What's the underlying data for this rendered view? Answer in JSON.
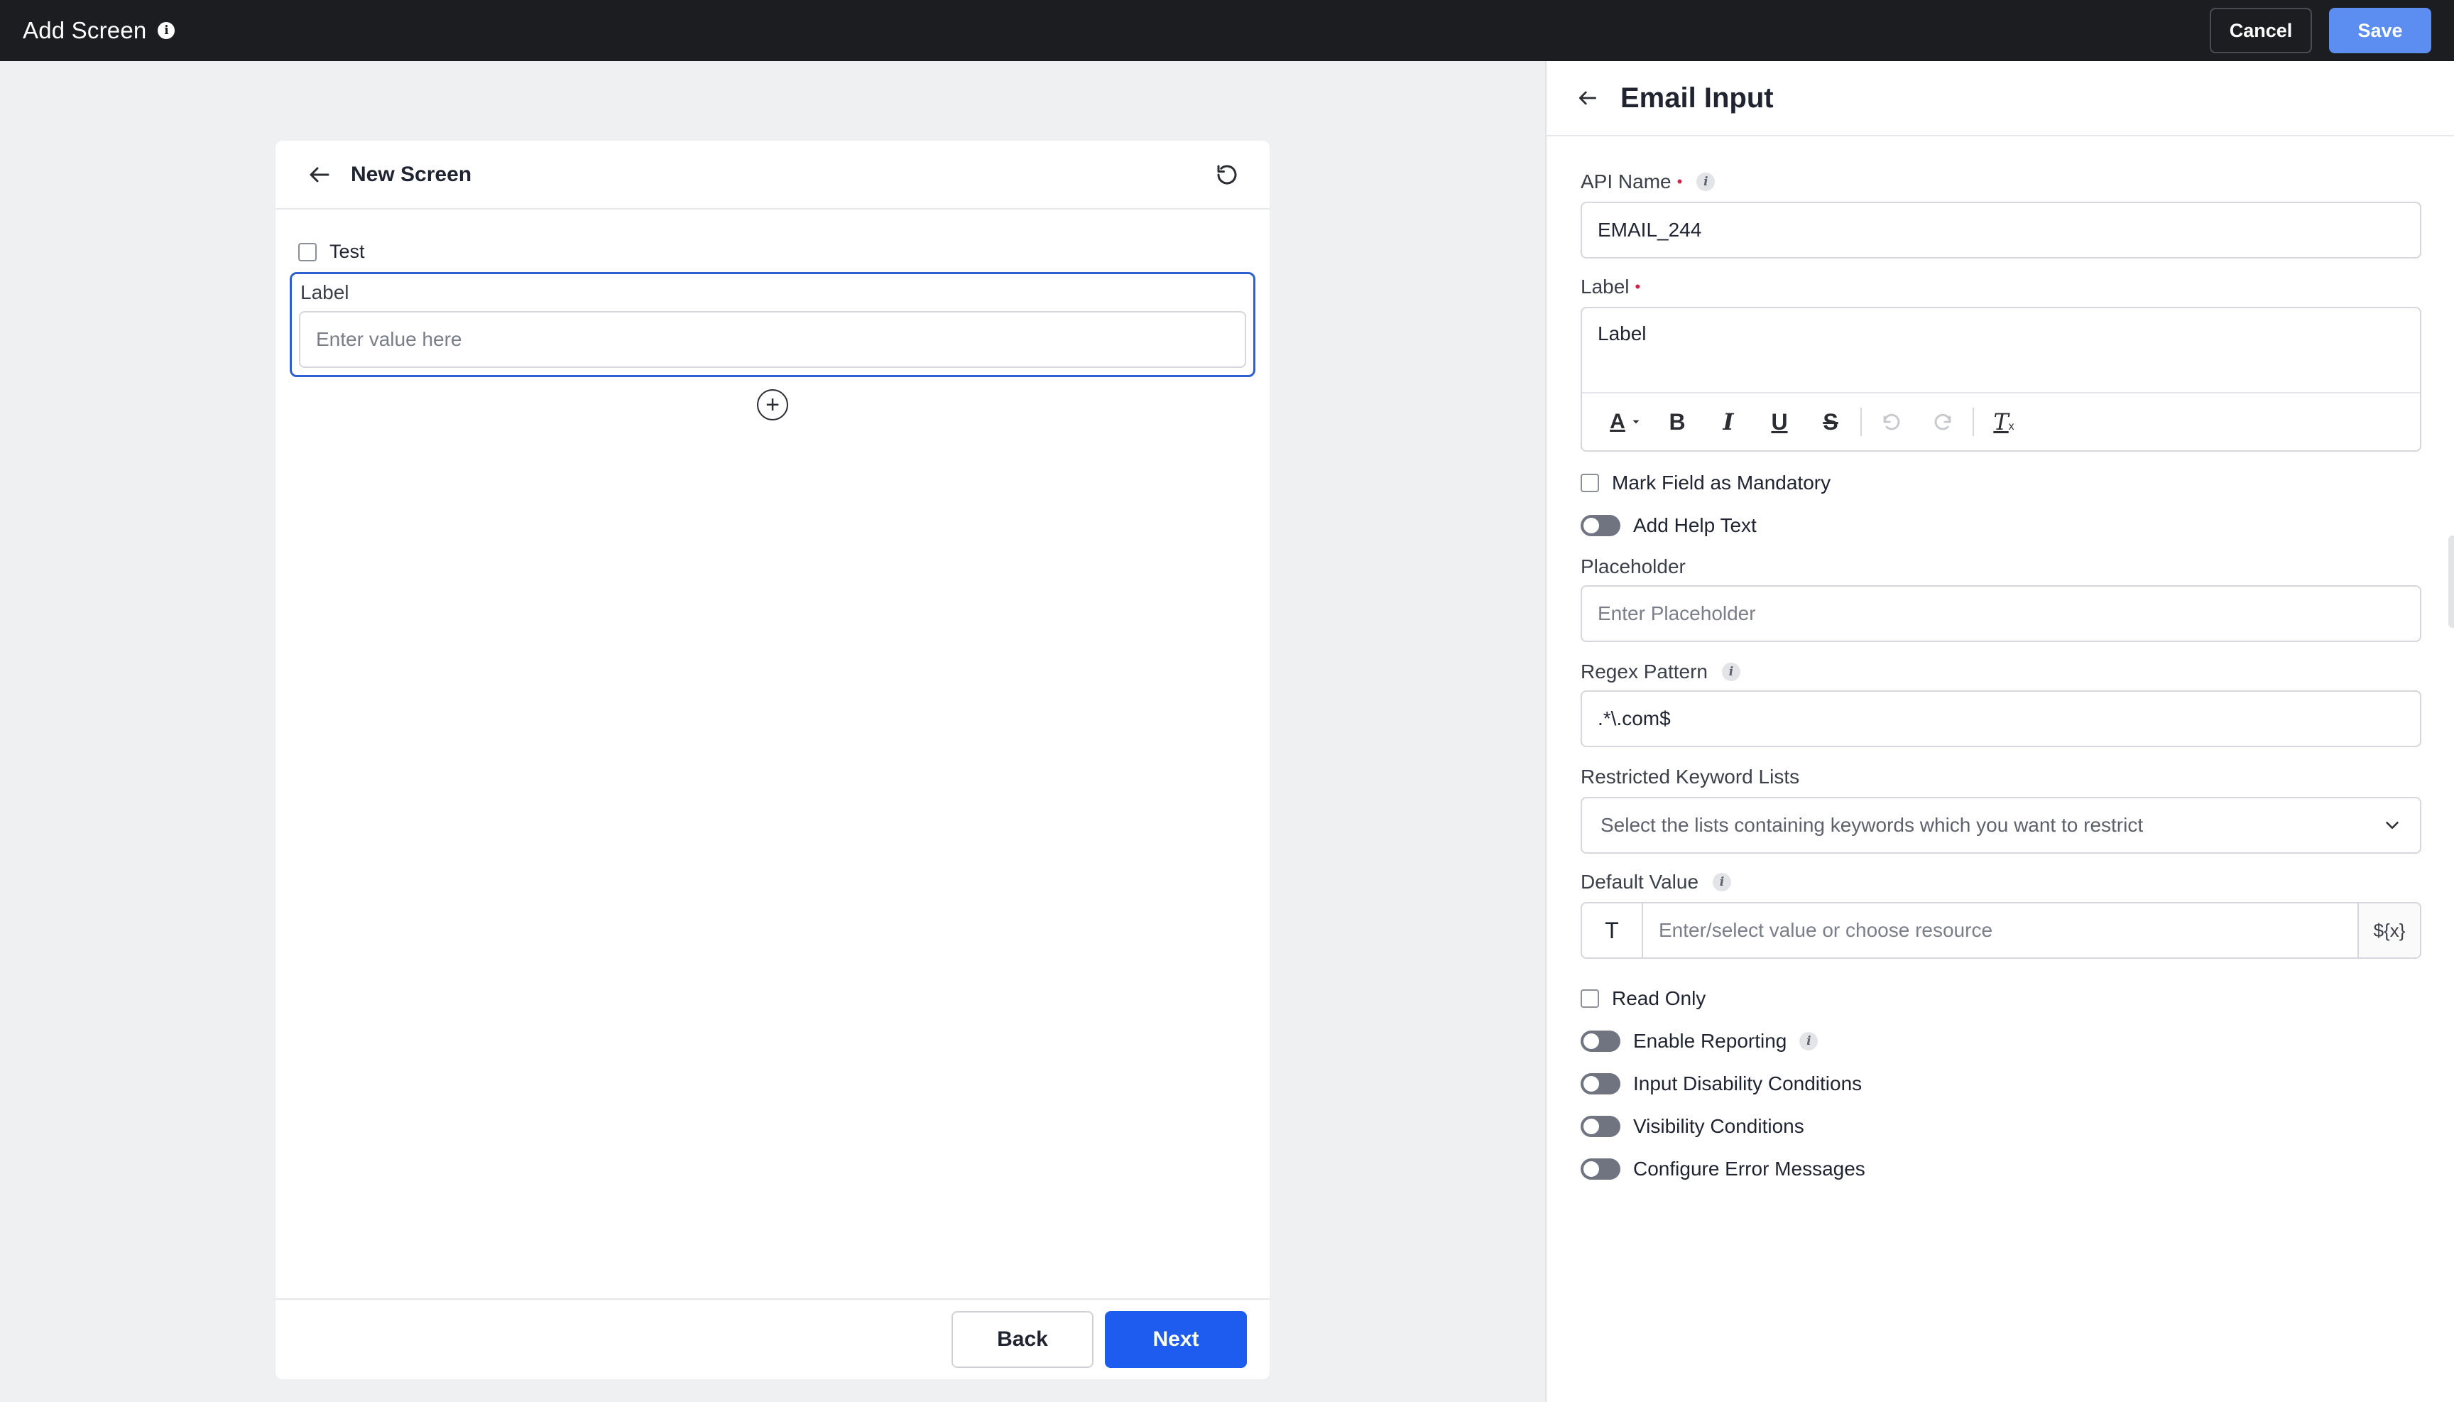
{
  "header": {
    "title": "Add Screen",
    "info_icon": "info-icon",
    "cancel_label": "Cancel",
    "save_label": "Save"
  },
  "screen": {
    "title": "New Screen",
    "checkbox_label": "Test",
    "field_label": "Label",
    "field_placeholder": "Enter value here",
    "back_label": "Back",
    "next_label": "Next"
  },
  "panel": {
    "title": "Email Input",
    "api_name_label": "API Name",
    "api_name_value": "EMAIL_244",
    "label_label": "Label",
    "label_value": "Label",
    "toolbar": {
      "text_color": "A",
      "bold": "B",
      "italic": "I",
      "underline": "U",
      "strike": "S",
      "clear_format": "T"
    },
    "mandatory_label": "Mark Field as Mandatory",
    "help_text_label": "Add Help Text",
    "placeholder_label": "Placeholder",
    "placeholder_placeholder": "Enter Placeholder",
    "regex_label": "Regex Pattern",
    "regex_value": ".*\\.com$",
    "keyword_label": "Restricted Keyword Lists",
    "keyword_placeholder": "Select the lists containing keywords which you want to restrict",
    "default_label": "Default Value",
    "default_type": "T",
    "default_placeholder": "Enter/select value or choose resource",
    "resource_label": "${x}",
    "read_only_label": "Read Only",
    "toggles": {
      "reporting": "Enable Reporting",
      "disability": "Input Disability Conditions",
      "visibility": "Visibility Conditions",
      "errors": "Configure Error Messages"
    }
  },
  "colors": {
    "topbar": "#1c1d21",
    "save": "#5b8ef0",
    "next": "#1e5bef",
    "selected_border": "#2f5fd0",
    "required": "#d2244b"
  }
}
